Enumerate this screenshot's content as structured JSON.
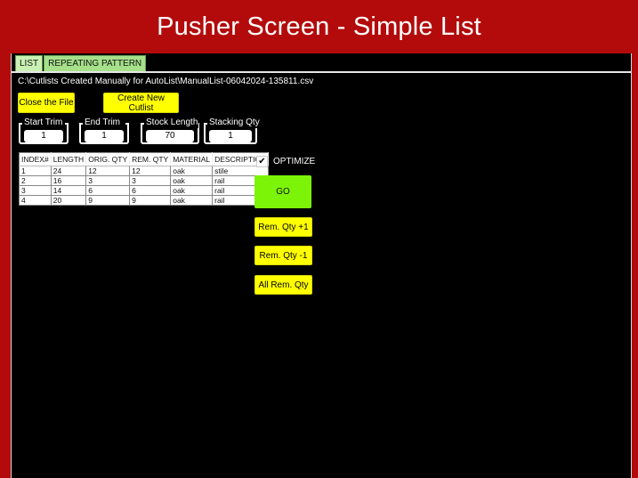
{
  "header": {
    "title": "Pusher Screen - Simple List"
  },
  "tabs": [
    {
      "label": "LIST"
    },
    {
      "label": "REPEATING PATTERN"
    }
  ],
  "file_path": "C:\\Cutlists Created Manually for AutoList\\ManualList-06042024-135811.csv",
  "buttons": {
    "close_file": "Close the File",
    "create_cutlist": "Create New Cutlist",
    "go": "GO",
    "rem_plus": "Rem. Qty +1",
    "rem_minus": "Rem. Qty -1",
    "all_rem": "All Rem. Qty"
  },
  "fields": {
    "start_trim": {
      "label": "Start Trim",
      "value": "1"
    },
    "end_trim": {
      "label": "End Trim",
      "value": "1"
    },
    "stock_length": {
      "label": "Stock Length",
      "value": "70"
    },
    "stacking_qty": {
      "label": "Stacking Qty",
      "value": "1"
    }
  },
  "table": {
    "headers": [
      "INDEX#",
      "LENGTH",
      "ORIG. QTY",
      "REM. QTY",
      "MATERIAL",
      "DESCRIPTION"
    ],
    "rows": [
      [
        "1",
        "24",
        "12",
        "12",
        "oak",
        "stile"
      ],
      [
        "2",
        "16",
        "3",
        "3",
        "oak",
        "rail"
      ],
      [
        "3",
        "14",
        "6",
        "6",
        "oak",
        "rail"
      ],
      [
        "4",
        "20",
        "9",
        "9",
        "oak",
        "rail"
      ]
    ]
  },
  "optimize": {
    "label": "OPTIMIZE",
    "checked": true,
    "check_glyph": "✔"
  },
  "colors": {
    "banner": "#b30b0b",
    "tab": "#a6e08a",
    "button": "#ffff00",
    "go": "#7cf408"
  }
}
